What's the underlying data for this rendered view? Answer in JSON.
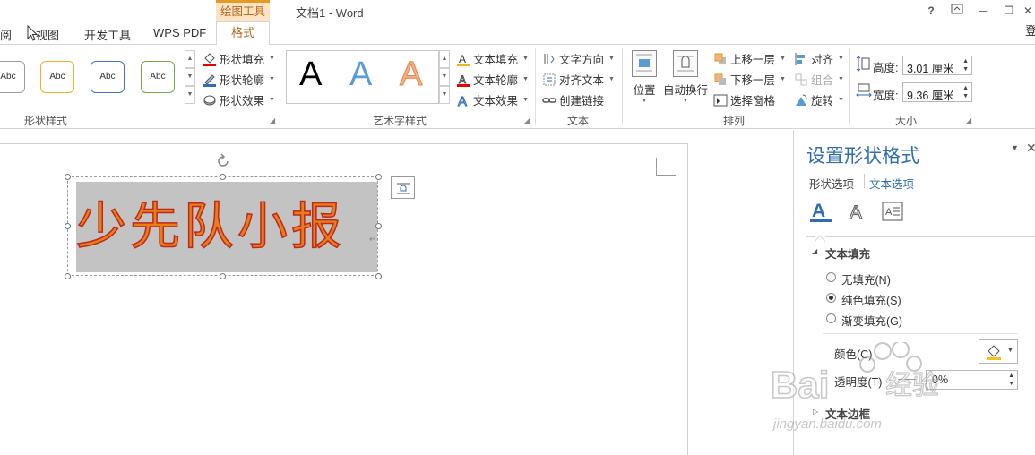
{
  "window": {
    "title": "文档1 - Word",
    "help": "?",
    "signin_partial": "登"
  },
  "tabs": {
    "review_partial": "阅",
    "view": "视图",
    "developer": "开发工具",
    "wps_pdf": "WPS PDF",
    "contextual_group": "绘图工具",
    "format": "格式"
  },
  "ribbon": {
    "shape_styles": {
      "label": "形状样式",
      "gallery": [
        "Abc",
        "Abc",
        "Abc",
        "Abc"
      ],
      "fill": "形状填充",
      "outline": "形状轮廓",
      "effects": "形状效果"
    },
    "wordart": {
      "label": "艺术字样式",
      "letters": [
        "A",
        "A",
        "A"
      ],
      "text_fill": "文本填充",
      "text_outline": "文本轮廓",
      "text_effects": "文本效果"
    },
    "text": {
      "label": "文本",
      "direction": "文字方向",
      "align": "对齐文本",
      "link": "创建链接"
    },
    "arrange": {
      "label": "排列",
      "position": "位置",
      "wrap": "自动换行",
      "bring_forward": "上移一层",
      "send_backward": "下移一层",
      "selection_pane": "选择窗格",
      "align": "对齐",
      "group": "组合",
      "rotate": "旋转"
    },
    "size": {
      "label": "大小",
      "height_label": "高度:",
      "height_value": "3.01 厘米",
      "width_label": "宽度:",
      "width_value": "9.36 厘米"
    }
  },
  "document": {
    "shape_text": "少先队小报"
  },
  "pane": {
    "title": "设置形状格式",
    "tab_shape": "形状选项",
    "tab_text": "文本选项",
    "section_fill": "文本填充",
    "options": [
      {
        "label": "无填充(N)",
        "selected": false
      },
      {
        "label": "纯色填充(S)",
        "selected": true
      },
      {
        "label": "渐变填充(G)",
        "selected": false
      }
    ],
    "color_label": "颜色(C)",
    "transparency_label": "透明度(T)",
    "transparency_value": "0%",
    "section_border": "文本边框",
    "accent_color": "#2f6db5"
  },
  "watermark": {
    "text": "Bai 经验",
    "url": "jingyan.baidu.com"
  }
}
